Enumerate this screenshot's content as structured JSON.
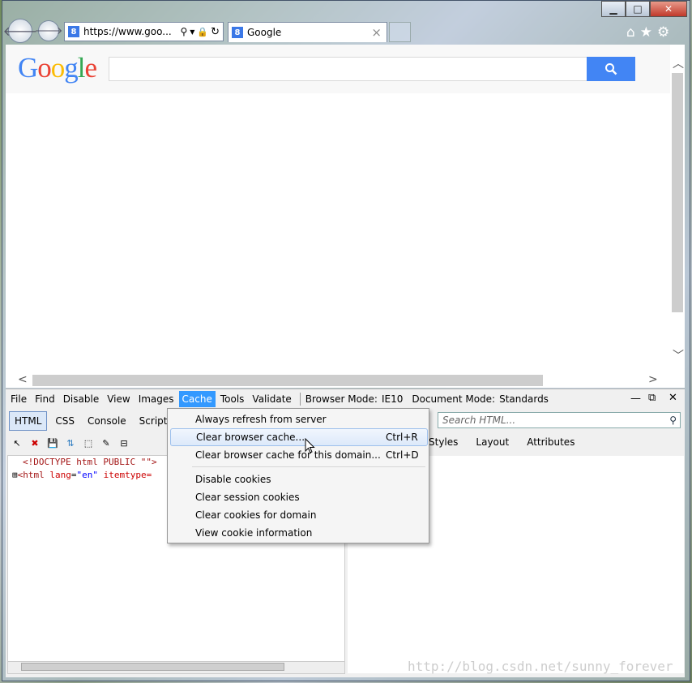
{
  "window": {
    "minimize": "▁",
    "maximize": "□",
    "close": "✕"
  },
  "address": {
    "url": "https://www.goo...",
    "favicon": "8"
  },
  "tab": {
    "title": "Google",
    "close": "×",
    "favicon": "8"
  },
  "page": {
    "logo": [
      "G",
      "o",
      "o",
      "g",
      "l",
      "e"
    ],
    "logo_colors": [
      "#4285f4",
      "#ea4335",
      "#fbbc05",
      "#4285f4",
      "#34a853",
      "#ea4335"
    ]
  },
  "devtools": {
    "menu": [
      "File",
      "Find",
      "Disable",
      "View",
      "Images",
      "Cache",
      "Tools",
      "Validate"
    ],
    "browser_mode_label": "Browser Mode:",
    "browser_mode": "IE10",
    "document_mode_label": "Document Mode:",
    "document_mode": "Standards",
    "tabs": [
      "HTML",
      "CSS",
      "Console",
      "Script"
    ],
    "search_placeholder": "Search HTML...",
    "right_tabs": [
      "Styles",
      "Layout",
      "Attributes"
    ],
    "code_lines": {
      "doctype": "<!DOCTYPE html PUBLIC \"\">",
      "html_open": "<html ",
      "lang_attr": "lang",
      "lang_val": "\"en\"",
      "itemtype": "itemtype="
    }
  },
  "cache_menu": {
    "items": [
      {
        "label": "Always refresh from server",
        "shortcut": ""
      },
      {
        "label": "Clear browser cache...",
        "shortcut": "Ctrl+R"
      },
      {
        "label": "Clear browser cache for this domain...",
        "shortcut": "Ctrl+D"
      },
      {
        "label": "Disable cookies",
        "shortcut": ""
      },
      {
        "label": "Clear session cookies",
        "shortcut": ""
      },
      {
        "label": "Clear cookies for domain",
        "shortcut": ""
      },
      {
        "label": "View cookie information",
        "shortcut": ""
      }
    ]
  },
  "watermark": "http://blog.csdn.net/sunny_forever"
}
